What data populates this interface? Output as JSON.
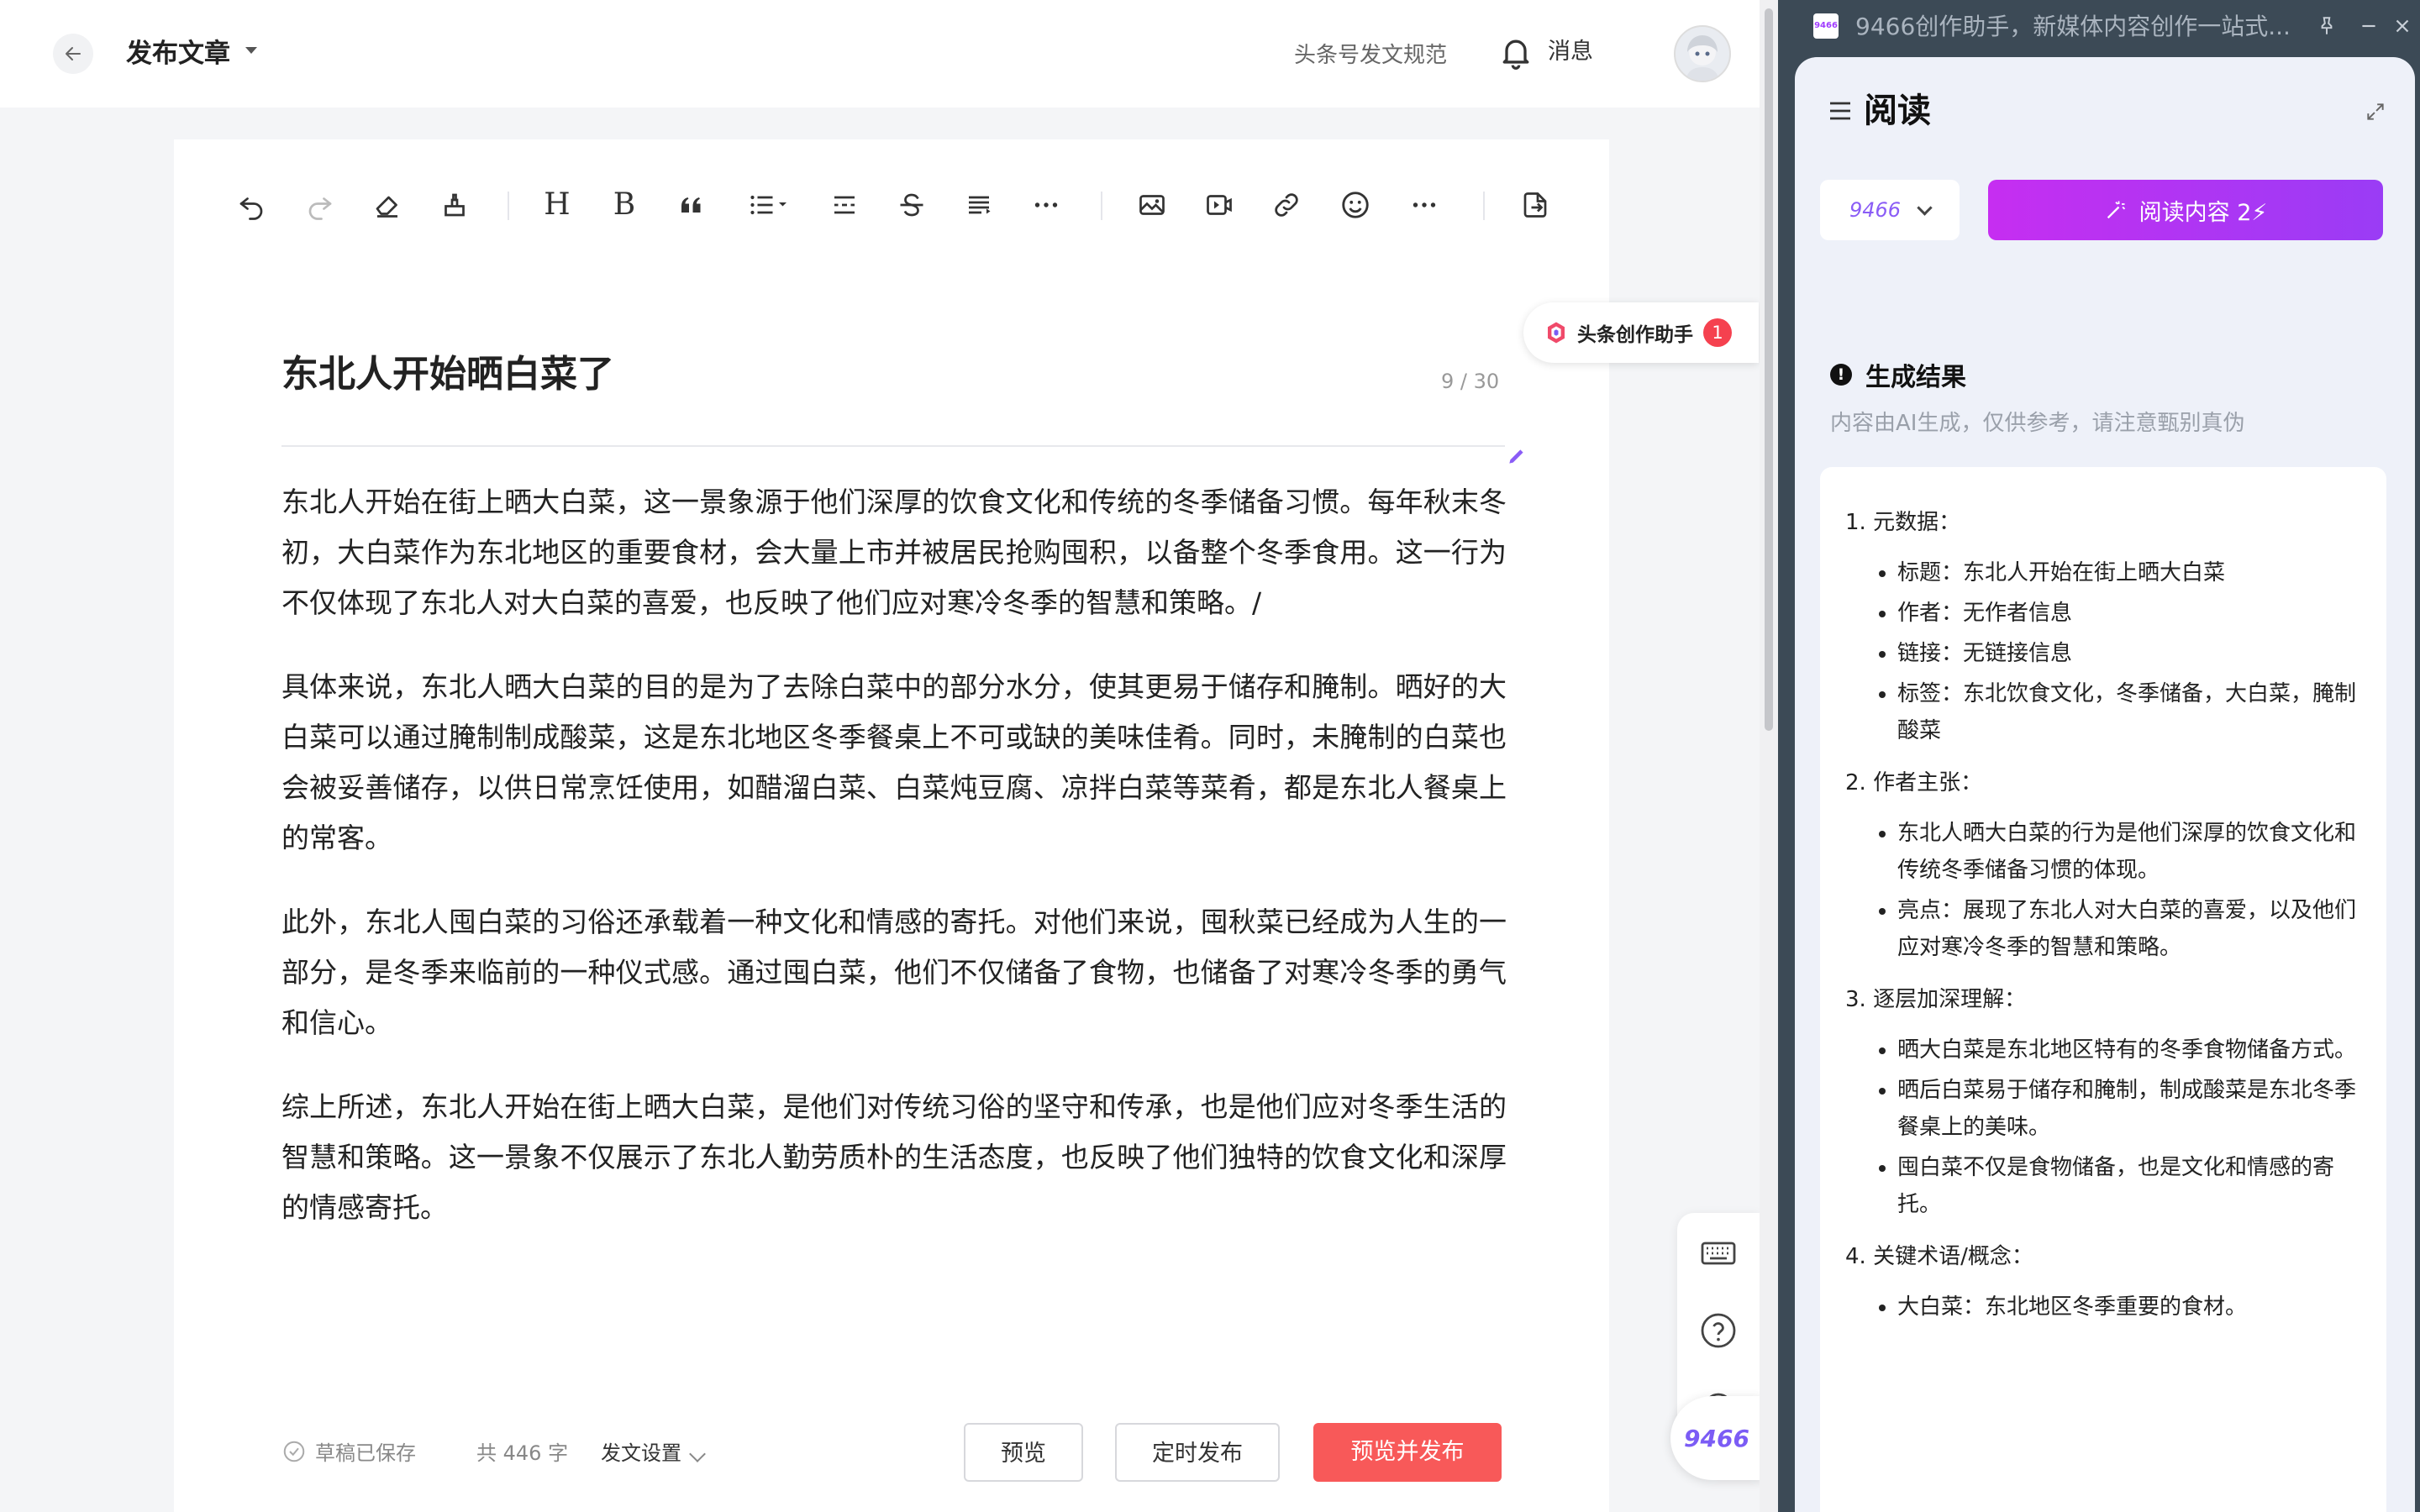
{
  "header": {
    "page_title": "发布文章",
    "guide_link": "头条号发文规范",
    "messages_label": "消息"
  },
  "editor": {
    "title": "东北人开始晒白菜了",
    "title_count": "9 / 30",
    "paragraphs": [
      "东北人开始在街上晒大白菜，这一景象源于他们深厚的饮食文化和传统的冬季储备习惯。每年秋末冬初，大白菜作为东北地区的重要食材，会大量上市并被居民抢购囤积，以备整个冬季食用。这一行为不仅体现了东北人对大白菜的喜爱，也反映了他们应对寒冷冬季的智慧和策略。/",
      "具体来说，东北人晒大白菜的目的是为了去除白菜中的部分水分，使其更易于储存和腌制。晒好的大白菜可以通过腌制制成酸菜，这是东北地区冬季餐桌上不可或缺的美味佳肴。同时，未腌制的白菜也会被妥善储存，以供日常烹饪使用，如醋溜白菜、白菜炖豆腐、凉拌白菜等菜肴，都是东北人餐桌上的常客。",
      "此外，东北人囤白菜的习俗还承载着一种文化和情感的寄托。对他们来说，囤秋菜已经成为人生的一部分，是冬季来临前的一种仪式感。通过囤白菜，他们不仅储备了食物，也储备了对寒冷冬季的勇气和信心。",
      "综上所述，东北人开始在街上晒大白菜，是他们对传统习俗的坚守和传承，也是他们应对冬季生活的智慧和策略。这一景象不仅展示了东北人勤劳质朴的生活态度，也反映了他们独特的饮食文化和深厚的情感寄托。"
    ],
    "toolbar": {
      "heading": "H",
      "bold": "B"
    }
  },
  "assistant": {
    "label": "头条创作助手",
    "badge": "1"
  },
  "footer": {
    "saved": "草稿已保存",
    "word_count": "共 446 字",
    "publish_settings": "发文设置",
    "preview": "预览",
    "schedule": "定时发布",
    "preview_publish": "预览并发布"
  },
  "float_button": "9466",
  "panel": {
    "window_title": "9466创作助手，新媒体内容创作一站式...",
    "logo_text": "9466",
    "title": "阅读",
    "model": "9466",
    "read_button": "阅读内容 2⚡",
    "result_heading": "生成结果",
    "result_note": "内容由AI生成，仅供参考，请注意甄别真伪",
    "sections": [
      {
        "title": "1. 元数据：",
        "items": [
          "标题：东北人开始在街上晒大白菜",
          "作者：无作者信息",
          "链接：无链接信息",
          "标签：东北饮食文化，冬季储备，大白菜，腌制酸菜"
        ]
      },
      {
        "title": "2. 作者主张：",
        "items": [
          "东北人晒大白菜的行为是他们深厚的饮食文化和传统冬季储备习惯的体现。",
          "亮点：展现了东北人对大白菜的喜爱，以及他们应对寒冷冬季的智慧和策略。"
        ]
      },
      {
        "title": "3. 逐层加深理解：",
        "items": [
          "晒大白菜是东北地区特有的冬季食物储备方式。",
          "晒后白菜易于储存和腌制，制成酸菜是东北冬季餐桌上的美味。",
          "囤白菜不仅是食物储备，也是文化和情感的寄托。"
        ]
      },
      {
        "title": "4. 关键术语/概念：",
        "items": [
          "大白菜：东北地区冬季重要的食材。"
        ]
      }
    ]
  }
}
